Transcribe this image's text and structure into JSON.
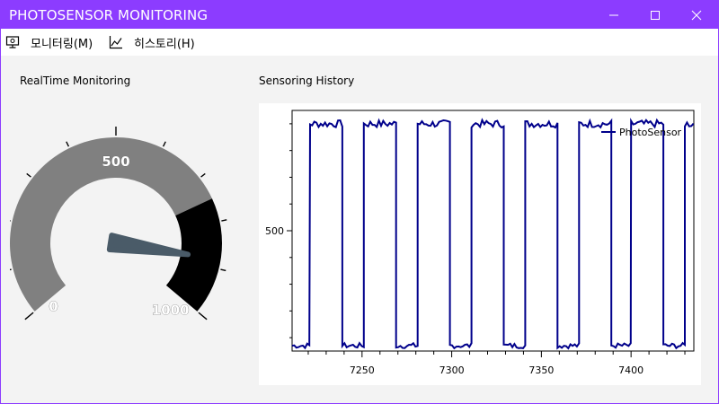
{
  "window": {
    "title": "PHOTOSENSOR MONITORING",
    "minimize_glyph": "—",
    "maximize_glyph": "☐",
    "close_glyph": "✕",
    "titlebar_color": "#8c3cff"
  },
  "menu": {
    "items": [
      {
        "label": "모니터링(M)",
        "icon": "monitor-icon"
      },
      {
        "label": "히스토리(H)",
        "icon": "line-chart-icon"
      }
    ]
  },
  "sections": {
    "realtime": "RealTime Monitoring",
    "history": "Sensoring History"
  },
  "gauge": {
    "min": 0,
    "max": 1000,
    "tick_labels": [
      "0",
      "500",
      "1000"
    ],
    "needle_value": 880,
    "band_color_normal": "#808080",
    "band_color_high": "#000000",
    "high_from": 750,
    "needle_color": "#4a5b68"
  },
  "chart_data": {
    "type": "line",
    "x_tick_labels": [
      "7250",
      "7300",
      "7350",
      "7400"
    ],
    "y_tick_labels": [
      "500"
    ],
    "xlim": [
      7211,
      7435
    ],
    "ylim": [
      50,
      950
    ],
    "series": [
      {
        "name": "PhotoSensor",
        "color": "#00008b",
        "segments": [
          {
            "x_start": 7211,
            "x_end": 7221,
            "level": "low"
          },
          {
            "x_start": 7221,
            "x_end": 7239,
            "level": "high"
          },
          {
            "x_start": 7239,
            "x_end": 7251,
            "level": "low"
          },
          {
            "x_start": 7251,
            "x_end": 7269,
            "level": "high"
          },
          {
            "x_start": 7269,
            "x_end": 7281,
            "level": "low"
          },
          {
            "x_start": 7281,
            "x_end": 7299,
            "level": "high"
          },
          {
            "x_start": 7299,
            "x_end": 7311,
            "level": "low"
          },
          {
            "x_start": 7311,
            "x_end": 7329,
            "level": "high"
          },
          {
            "x_start": 7329,
            "x_end": 7341,
            "level": "low"
          },
          {
            "x_start": 7341,
            "x_end": 7359,
            "level": "high"
          },
          {
            "x_start": 7359,
            "x_end": 7371,
            "level": "low"
          },
          {
            "x_start": 7371,
            "x_end": 7389,
            "level": "high"
          },
          {
            "x_start": 7389,
            "x_end": 7400,
            "level": "low"
          },
          {
            "x_start": 7400,
            "x_end": 7418,
            "level": "high"
          },
          {
            "x_start": 7418,
            "x_end": 7430,
            "level": "low"
          },
          {
            "x_start": 7430,
            "x_end": 7435,
            "level": "high"
          }
        ],
        "high_value": 900,
        "low_value": 70
      }
    ],
    "legend": {
      "position": "top-right",
      "label": "PhotoSensor"
    }
  }
}
